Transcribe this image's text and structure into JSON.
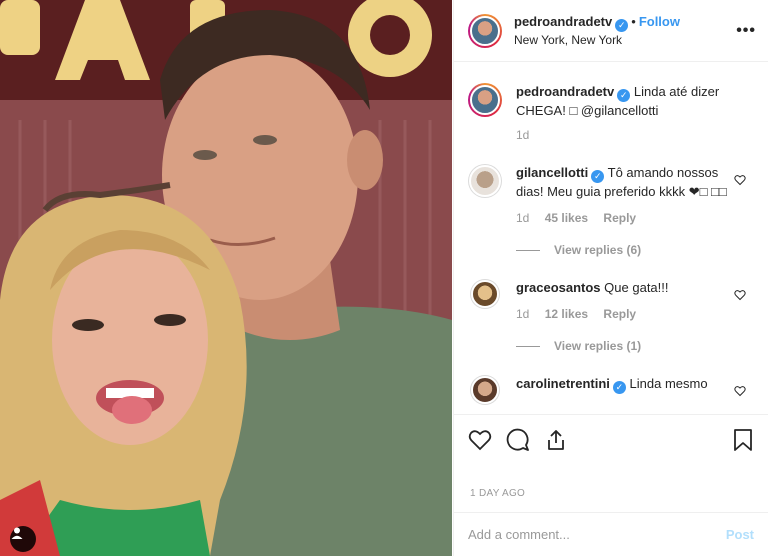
{
  "post": {
    "username": "pedroandradetv",
    "follow_label": "Follow",
    "location": "New York, New York",
    "more_label": "•••",
    "tag_icon": "user-icon"
  },
  "caption": {
    "username": "pedroandradetv",
    "text": "Linda até dizer CHEGA! □ @gilancellotti",
    "time": "1d"
  },
  "comments": [
    {
      "username": "gilancellotti",
      "verified": true,
      "text": "Tô amando nossos dias! Meu guia preferido kkkk ❤□ □□",
      "time": "1d",
      "likes": "45 likes",
      "reply_label": "Reply",
      "view_replies": "View replies (6)"
    },
    {
      "username": "graceosantos",
      "verified": false,
      "text": "Que gata!!!",
      "time": "1d",
      "likes": "12 likes",
      "reply_label": "Reply",
      "view_replies": "View replies (1)"
    },
    {
      "username": "carolinetrentini",
      "verified": true,
      "text": "Linda mesmo"
    }
  ],
  "footer": {
    "posted_ago": "1 DAY AGO",
    "comment_placeholder": "Add a comment...",
    "post_label": "Post"
  },
  "colors": {
    "accent": "#3897f0",
    "post_disabled": "#b2dffc",
    "muted": "#999999"
  }
}
